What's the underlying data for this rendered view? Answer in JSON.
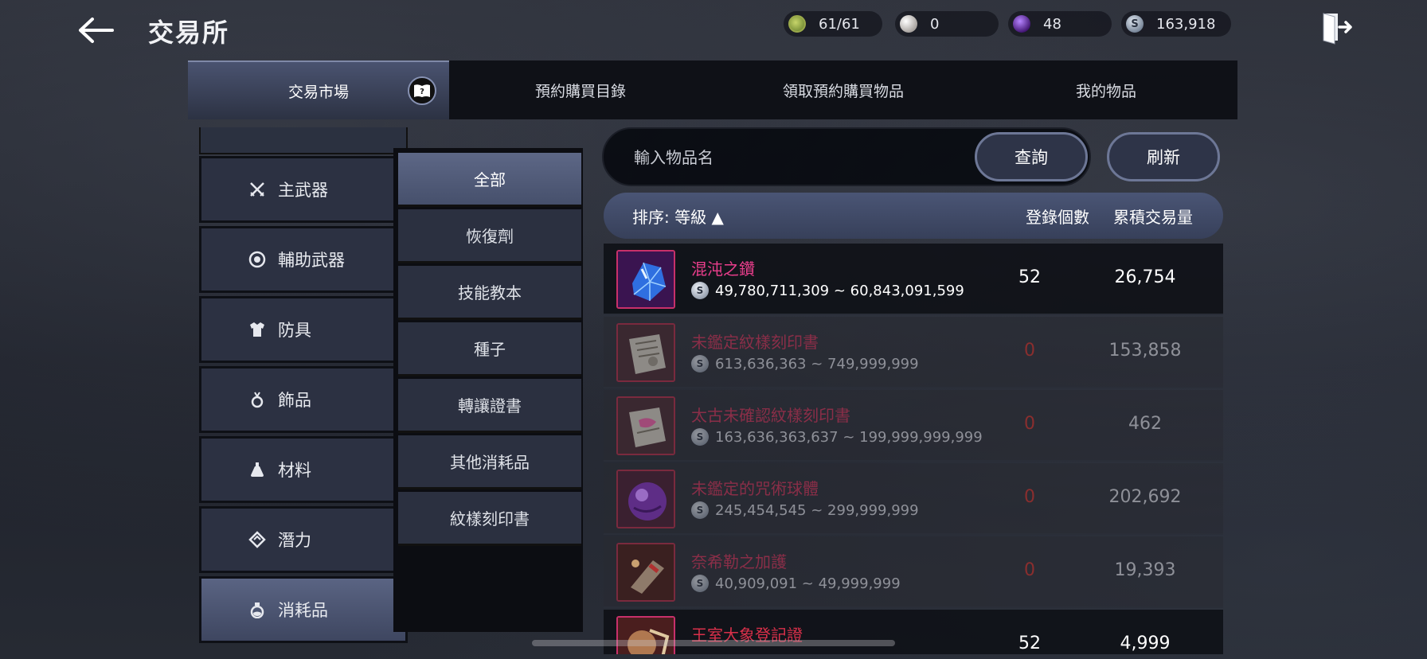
{
  "header": {
    "title": "交易所",
    "resources": [
      {
        "icon": "green-energy-icon",
        "value": "61/61"
      },
      {
        "icon": "pearl-icon",
        "value": "0"
      },
      {
        "icon": "purple-crystal-icon",
        "value": "48"
      },
      {
        "icon": "silver-coin-icon",
        "value": "163,918"
      }
    ]
  },
  "tabs": [
    {
      "label": "交易市場",
      "active": true
    },
    {
      "label": "預約購買目錄",
      "active": false
    },
    {
      "label": "領取預約購買物品",
      "active": false
    },
    {
      "label": "我的物品",
      "active": false
    }
  ],
  "categories": [
    {
      "icon": "crossed-swords-icon",
      "label": "主武器"
    },
    {
      "icon": "ring-target-icon",
      "label": "輔助武器"
    },
    {
      "icon": "armor-icon",
      "label": "防具"
    },
    {
      "icon": "accessory-icon",
      "label": "飾品"
    },
    {
      "icon": "flask-icon",
      "label": "材料"
    },
    {
      "icon": "potential-icon",
      "label": "潛力"
    },
    {
      "icon": "potion-icon",
      "label": "消耗品",
      "active": true
    }
  ],
  "subcategories": [
    {
      "label": "全部",
      "active": true
    },
    {
      "label": "恢復劑"
    },
    {
      "label": "技能教本"
    },
    {
      "label": "種子"
    },
    {
      "label": "轉讓證書"
    },
    {
      "label": "其他消耗品"
    },
    {
      "label": "紋樣刻印書"
    }
  ],
  "search": {
    "placeholder": "輸入物品名",
    "query_label": "查詢",
    "refresh_label": "刷新"
  },
  "table": {
    "sort_label": "排序: 等級 ▲",
    "count_header": "登錄個數",
    "volume_header": "累積交易量",
    "rows": [
      {
        "name": "混沌之鑽",
        "price": "49,780,711,309 ~ 60,843,091,599",
        "count": "52",
        "volume": "26,754",
        "thumb": "blue-gem"
      },
      {
        "name": "未鑑定紋樣刻印書",
        "price": "613,636,363 ~ 749,999,999",
        "count": "0",
        "volume": "153,858",
        "thumb": "scroll"
      },
      {
        "name": "太古未確認紋樣刻印書",
        "price": "163,636,363,637 ~ 199,999,999,999",
        "count": "0",
        "volume": "462",
        "thumb": "scroll-pink"
      },
      {
        "name": "未鑑定的咒術球體",
        "price": "245,454,545 ~ 299,999,999",
        "count": "0",
        "volume": "202,692",
        "thumb": "purple-orb"
      },
      {
        "name": "奈希勒之加護",
        "price": "40,909,091 ~ 49,999,999",
        "count": "0",
        "volume": "19,393",
        "thumb": "potion"
      },
      {
        "name": "王室大象登記證",
        "price": "",
        "count": "52",
        "volume": "4,999",
        "thumb": "certificate"
      }
    ]
  }
}
